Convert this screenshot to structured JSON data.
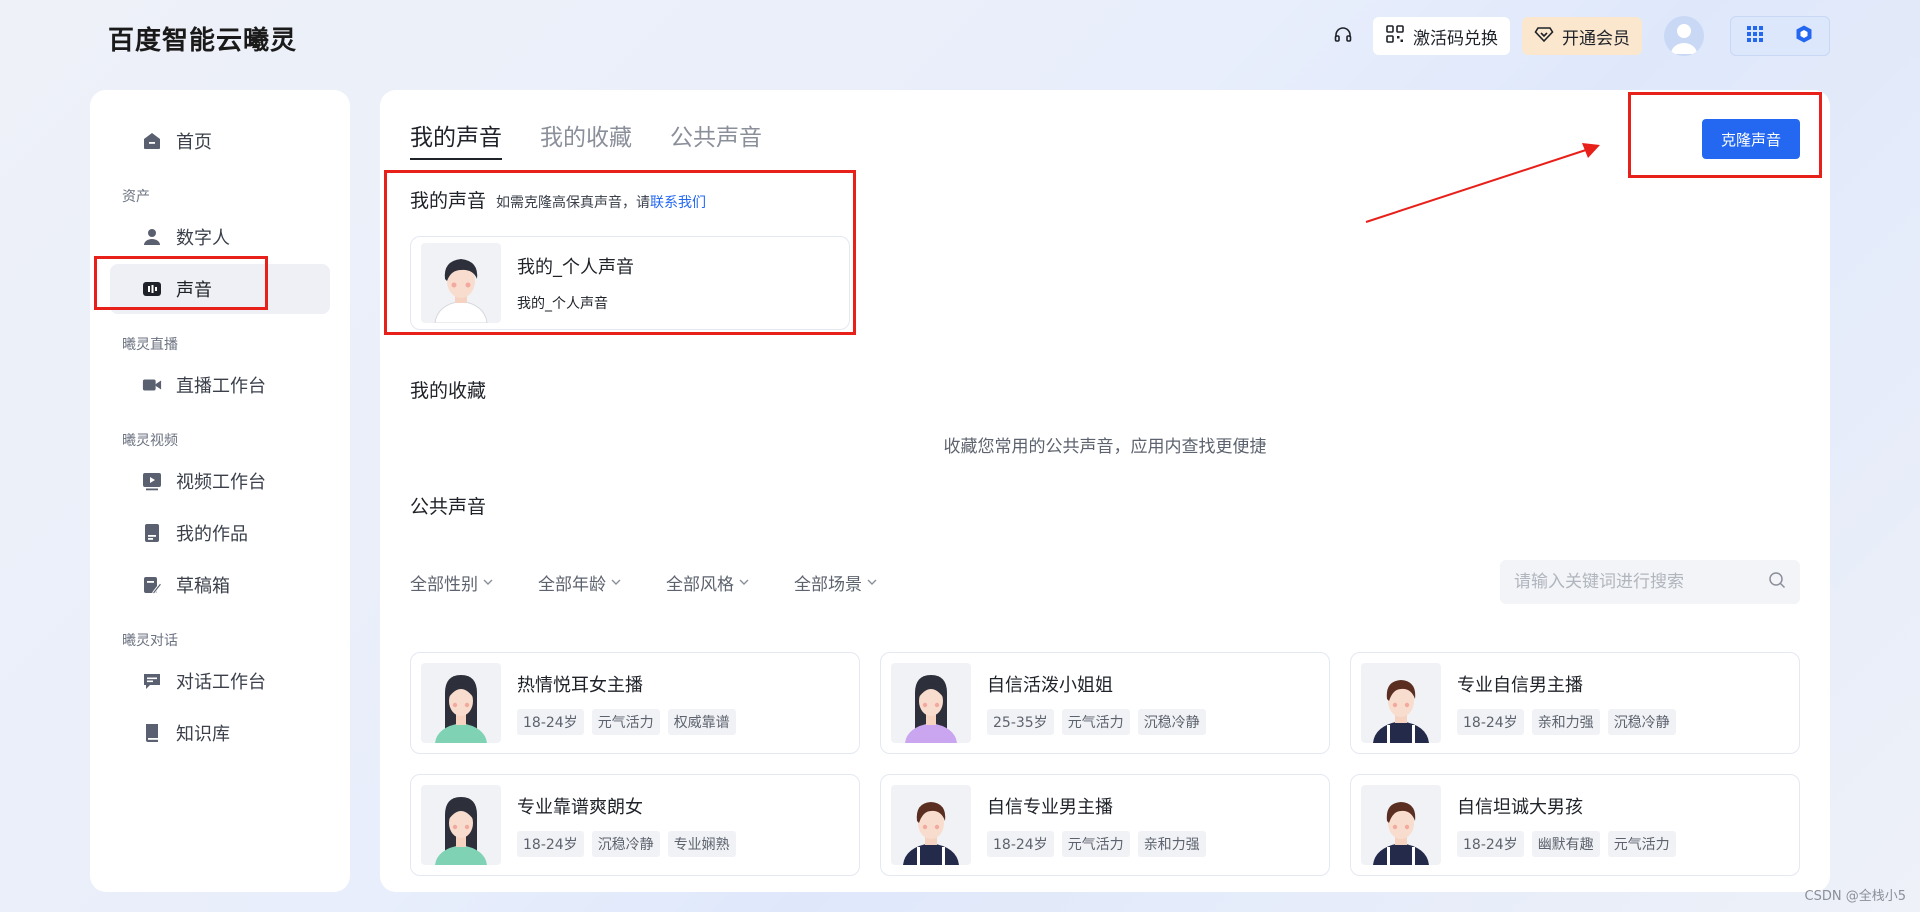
{
  "header": {
    "logo": "百度智能云曦灵",
    "redeem_label": "激活码兑换",
    "vip_label": "开通会员"
  },
  "sidebar": {
    "home": "首页",
    "groups": [
      {
        "label": "资产",
        "items": [
          "数字人",
          "声音"
        ]
      },
      {
        "label": "曦灵直播",
        "items": [
          "直播工作台"
        ]
      },
      {
        "label": "曦灵视频",
        "items": [
          "视频工作台",
          "我的作品",
          "草稿箱"
        ]
      },
      {
        "label": "曦灵对话",
        "items": [
          "对话工作台",
          "知识库"
        ]
      }
    ]
  },
  "main": {
    "tabs": [
      "我的声音",
      "我的收藏",
      "公共声音"
    ],
    "clone_button": "克隆声音",
    "my_voice": {
      "title": "我的声音",
      "hint": "如需克隆高保真声音，请",
      "hint_link": "联系我们",
      "card": {
        "name": "我的_个人声音",
        "sub": "我的_个人声音"
      }
    },
    "favorites": {
      "title": "我的收藏",
      "empty": "收藏您常用的公共声音，应用内查找更便捷"
    },
    "public": {
      "title": "公共声音",
      "filters": [
        "全部性别",
        "全部年龄",
        "全部风格",
        "全部场景"
      ],
      "search_placeholder": "请输入关键词进行搜索",
      "voices": [
        {
          "name": "热情悦耳女主播",
          "tags": [
            "18-24岁",
            "元气活力",
            "权威靠谱"
          ],
          "gender": "female",
          "shirt": "#7fd3b4"
        },
        {
          "name": "自信活泼小姐姐",
          "tags": [
            "25-35岁",
            "元气活力",
            "沉稳冷静"
          ],
          "gender": "female",
          "shirt": "#c9a6ef"
        },
        {
          "name": "专业自信男主播",
          "tags": [
            "18-24岁",
            "亲和力强",
            "沉稳冷静"
          ],
          "gender": "male",
          "shirt": "#242a4a"
        },
        {
          "name": "专业靠谱爽朗女",
          "tags": [
            "18-24岁",
            "沉稳冷静",
            "专业娴熟"
          ],
          "gender": "female",
          "shirt": "#7fd3b4"
        },
        {
          "name": "自信专业男主播",
          "tags": [
            "18-24岁",
            "元气活力",
            "亲和力强"
          ],
          "gender": "male",
          "shirt": "#242a4a"
        },
        {
          "name": "自信坦诚大男孩",
          "tags": [
            "18-24岁",
            "幽默有趣",
            "元气活力"
          ],
          "gender": "male",
          "shirt": "#242a4a"
        }
      ]
    }
  },
  "watermark": "CSDN @全栈小5",
  "colors": {
    "accent": "#2468f2",
    "highlight": "#e8201a",
    "vip_bg": "#fbe7cd"
  }
}
